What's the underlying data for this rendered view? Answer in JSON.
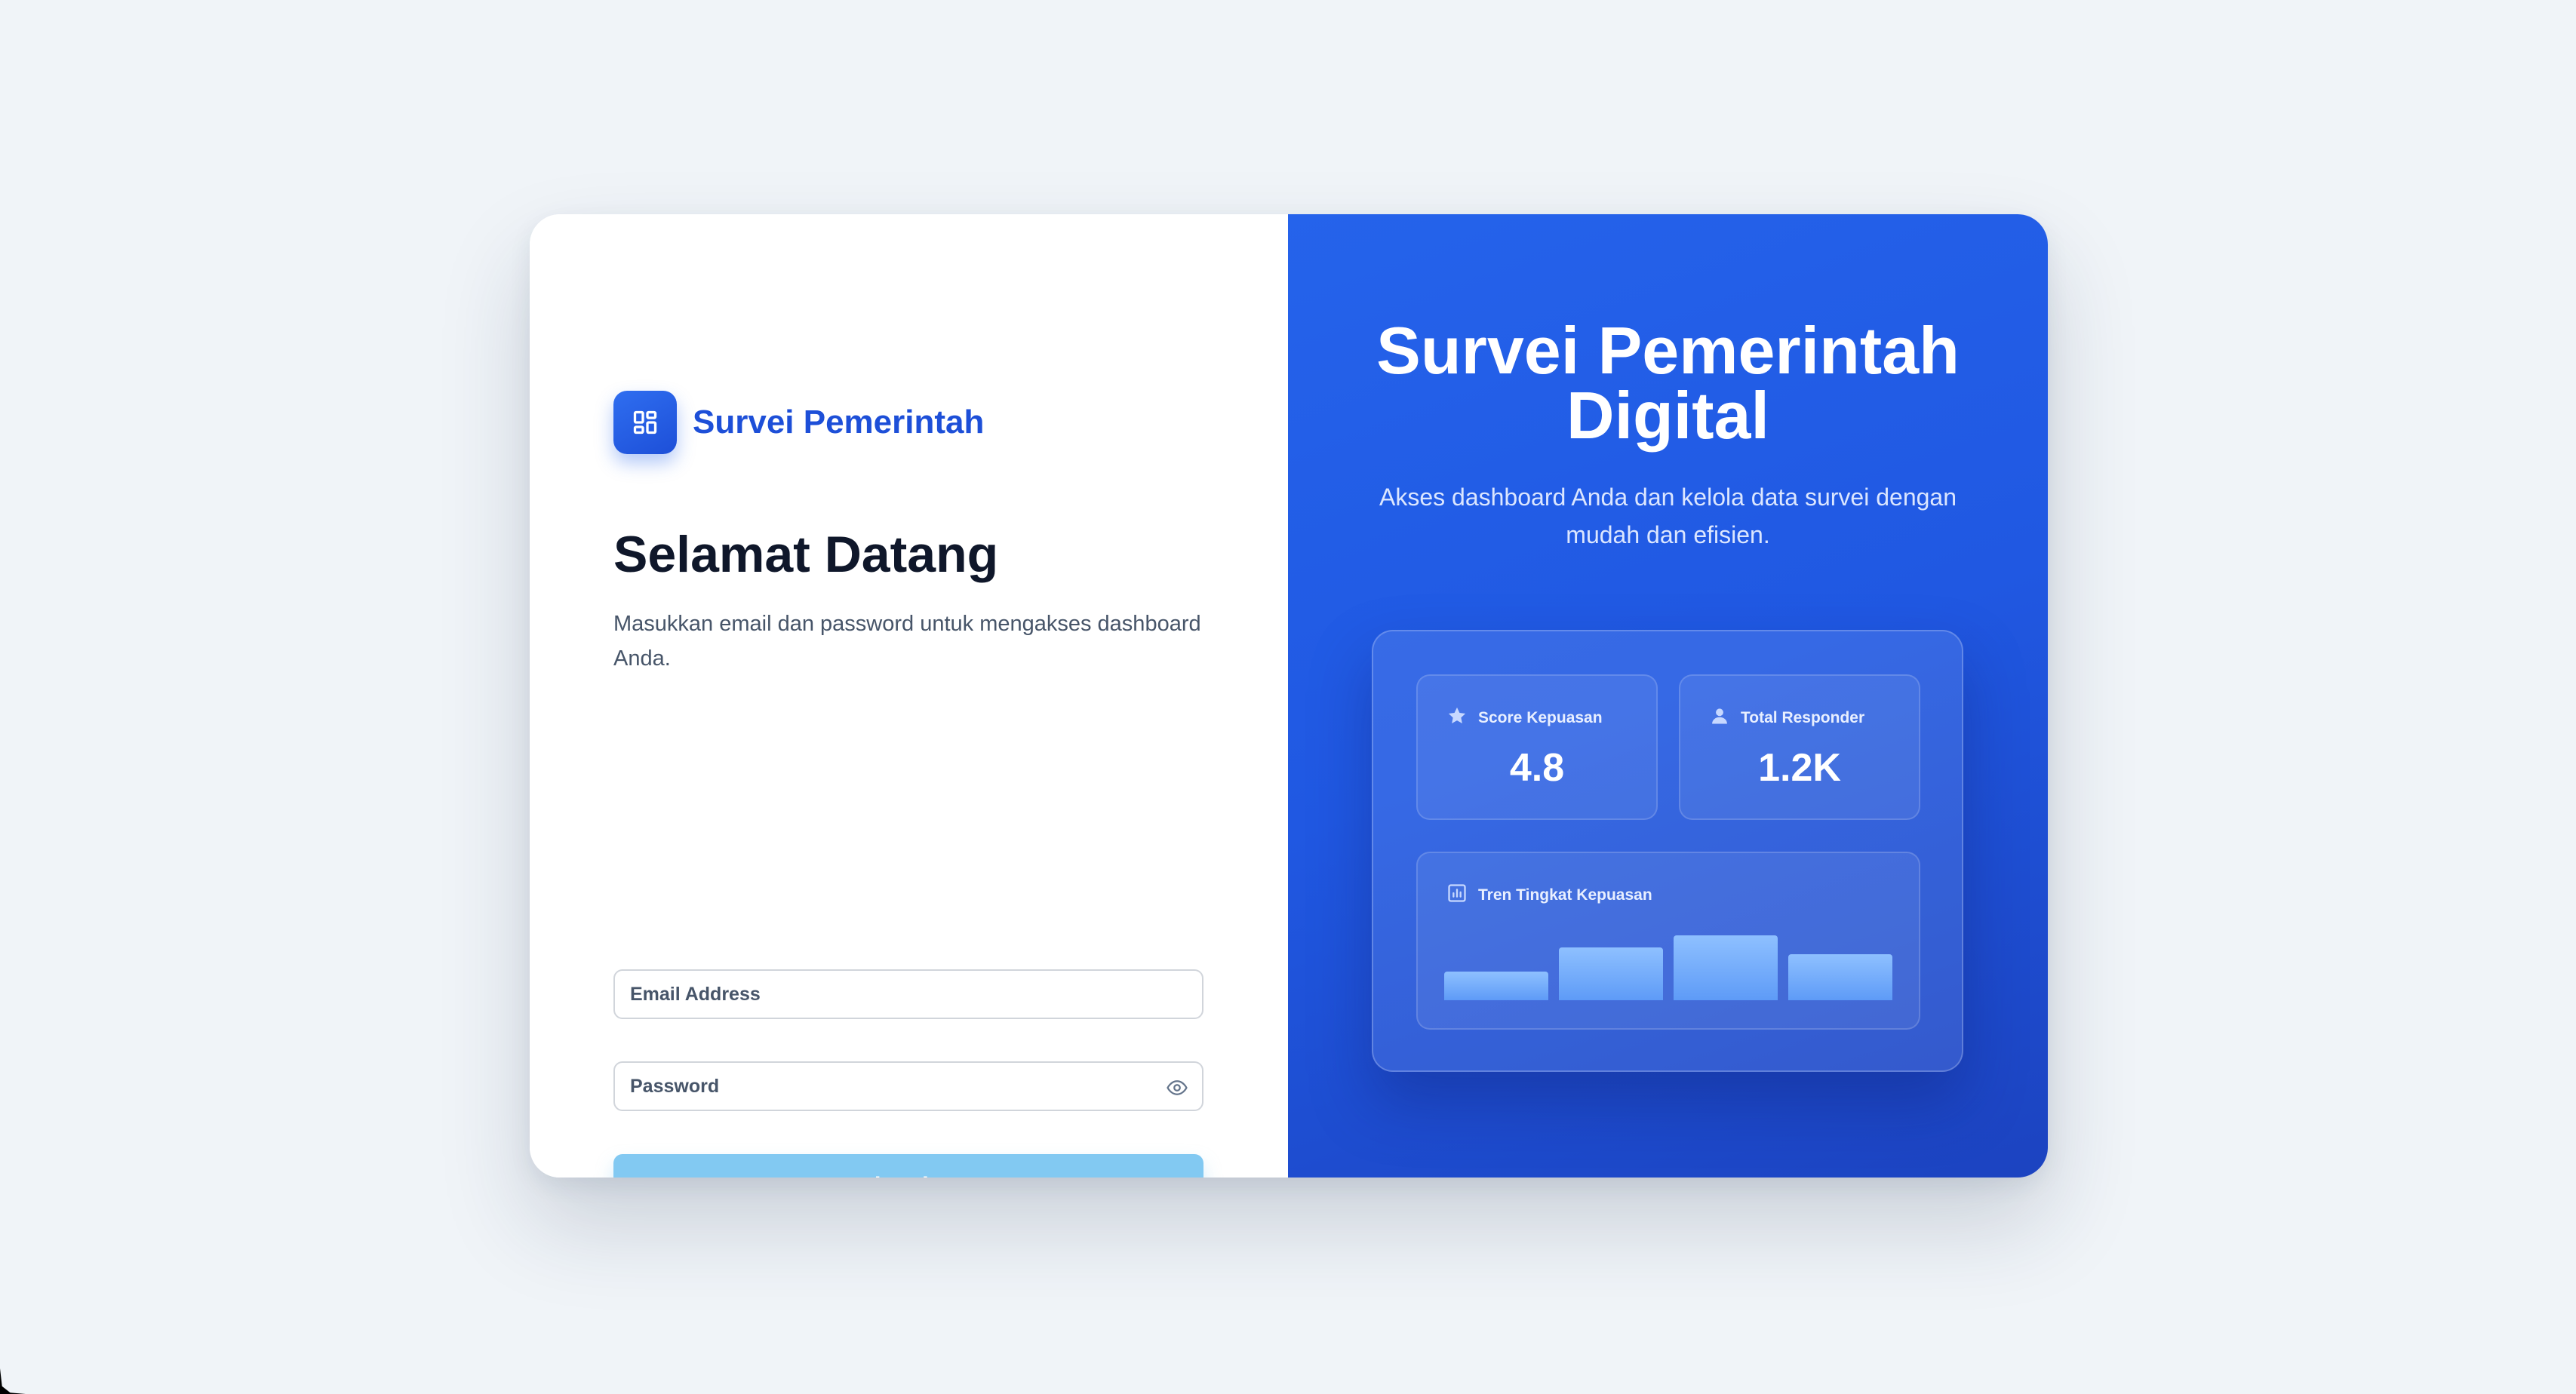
{
  "brand": {
    "name": "Survei Pemerintah",
    "icon": "dashboard-grid-icon"
  },
  "login": {
    "title": "Selamat Datang",
    "subtitle": "Masukkan email dan password untuk mengakses dashboard Anda.",
    "email_placeholder": "Email Address",
    "password_placeholder": "Password",
    "password_toggle_icon": "eye-icon",
    "submit_label": "Log In"
  },
  "hero": {
    "title": "Survei Pemerintah Digital",
    "subtitle": "Akses dashboard Anda dan kelola data survei dengan mudah dan efisien."
  },
  "stats": [
    {
      "label": "Score Kepuasan",
      "value": "4.8",
      "icon": "star-icon"
    },
    {
      "label": "Total Responder",
      "value": "1.2K",
      "icon": "user-icon"
    }
  ],
  "trend": {
    "label": "Tren Tingkat Kepuasan",
    "icon": "bar-chart-icon",
    "levels": [
      0.42,
      0.78,
      0.95,
      0.68
    ]
  },
  "colors": {
    "brand": "#1d4fd8",
    "hero_gradient_start": "#2563eb",
    "hero_gradient_end": "#1c43c0",
    "button": "#82c9f2",
    "bar": "#7db3fb"
  }
}
